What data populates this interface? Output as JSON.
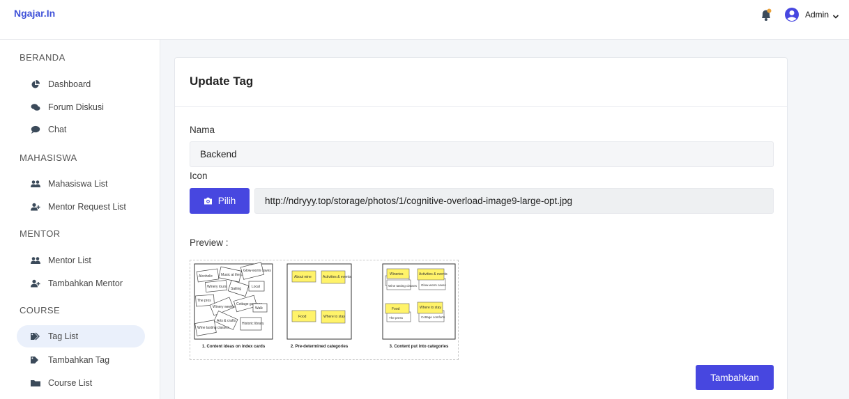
{
  "app": {
    "brand": "Ngajar.In"
  },
  "header": {
    "user_name": "Admin"
  },
  "sidebar": {
    "sections": [
      {
        "title": "BERANDA",
        "items": [
          {
            "label": "Dashboard",
            "icon": "chart-pie-icon"
          },
          {
            "label": "Forum Diskusi",
            "icon": "comments-icon"
          },
          {
            "label": "Chat",
            "icon": "comment-icon"
          }
        ]
      },
      {
        "title": "MAHASISWA",
        "items": [
          {
            "label": "Mahasiswa List",
            "icon": "users-icon"
          },
          {
            "label": "Mentor Request List",
            "icon": "user-plus-icon"
          }
        ]
      },
      {
        "title": "MENTOR",
        "items": [
          {
            "label": "Mentor List",
            "icon": "users-icon"
          },
          {
            "label": "Tambahkan Mentor",
            "icon": "user-plus-icon"
          }
        ]
      },
      {
        "title": "COURSE",
        "items": [
          {
            "label": "Tag List",
            "icon": "tags-icon",
            "active": true
          },
          {
            "label": "Tambahkan Tag",
            "icon": "tag-icon"
          },
          {
            "label": "Course List",
            "icon": "folder-icon"
          }
        ]
      }
    ]
  },
  "form": {
    "title": "Update Tag",
    "name_label": "Nama",
    "name_value": "Backend",
    "icon_label": "Icon",
    "pick_button": "Pilih",
    "icon_url": "http://ndryyy.top/storage/photos/1/cognitive-overload-image9-large-opt.jpg",
    "preview_label": "Preview :",
    "submit_button": "Tambahkan"
  },
  "preview_image": {
    "panels": [
      {
        "caption": "1. Content ideas on index cards",
        "cards": [
          "Alcoholic",
          "Music at the pub",
          "Glow-worm caves",
          "Winery tours",
          "Sailing",
          "Local",
          "The pros",
          "Winery weekend",
          "Cottage gardens",
          "Arts & crafts",
          "Historic library",
          "Wine tasting classes",
          "Walk"
        ]
      },
      {
        "caption": "2. Pre-determined categories",
        "cards": [
          "About wine",
          "Activities & events",
          "Food",
          "Where to stay"
        ]
      },
      {
        "caption": "3. Content put into categories",
        "cards": [
          "Wineries",
          "Activities & events",
          "Wine tasting classes",
          "Glow-worm caves",
          "Food",
          "Where to stay",
          "The press",
          "Cottage comforts"
        ]
      }
    ]
  },
  "colors": {
    "accent": "#4747e0",
    "brand": "#3f51d8",
    "active_bg": "#eaf0fb",
    "sticky_note": "#fff36a"
  }
}
